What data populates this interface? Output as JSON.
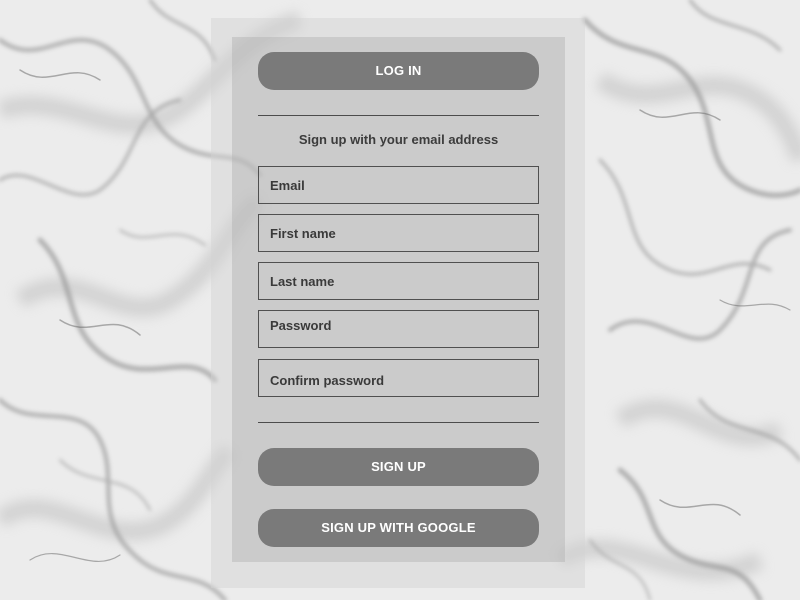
{
  "form": {
    "login_label": "LOG IN",
    "heading": "Sign up with your email address",
    "email_placeholder": "Email",
    "first_name_placeholder": "First name",
    "last_name_placeholder": "Last name",
    "password_placeholder": "Password",
    "confirm_password_placeholder": "Confirm password",
    "signup_label": "SIGN UP",
    "google_signup_label": "SIGN UP WITH GOOGLE"
  },
  "colors": {
    "button_fill": "#6e6e6e",
    "button_text": "#ffffff",
    "field_border": "#505050",
    "text": "#3a3a3a"
  }
}
